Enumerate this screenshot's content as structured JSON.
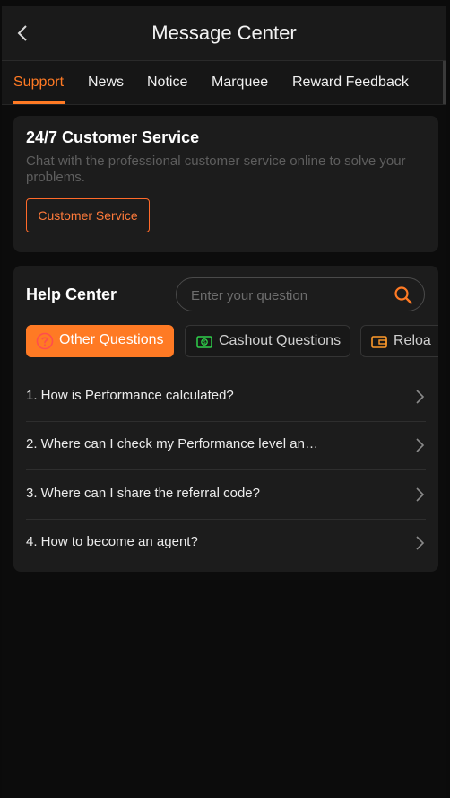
{
  "header": {
    "title": "Message Center"
  },
  "tabs": [
    {
      "label": "Support",
      "active": true
    },
    {
      "label": "News"
    },
    {
      "label": "Notice"
    },
    {
      "label": "Marquee"
    },
    {
      "label": "Reward Feedback"
    }
  ],
  "customer_service": {
    "title": "24/7 Customer Service",
    "description": "Chat with the professional customer service online to solve your problems.",
    "button_label": "Customer Service"
  },
  "help_center": {
    "title": "Help Center",
    "search_placeholder": "Enter your question",
    "categories": [
      {
        "label": "Other Questions",
        "icon": "question-icon",
        "active": true
      },
      {
        "label": "Cashout Questions",
        "icon": "cashout-icon"
      },
      {
        "label": "Reloa",
        "icon": "wallet-icon"
      }
    ],
    "questions": [
      "1. How is Performance calculated?",
      "2. Where can I check my Performance level an…",
      "3. Where can I share the referral code?",
      "4. How to become an agent?"
    ]
  },
  "colors": {
    "accent": "#ff7a24",
    "background": "#0c0c0c",
    "card": "#1c1c1c",
    "cashout_icon": "#2fd04a"
  }
}
